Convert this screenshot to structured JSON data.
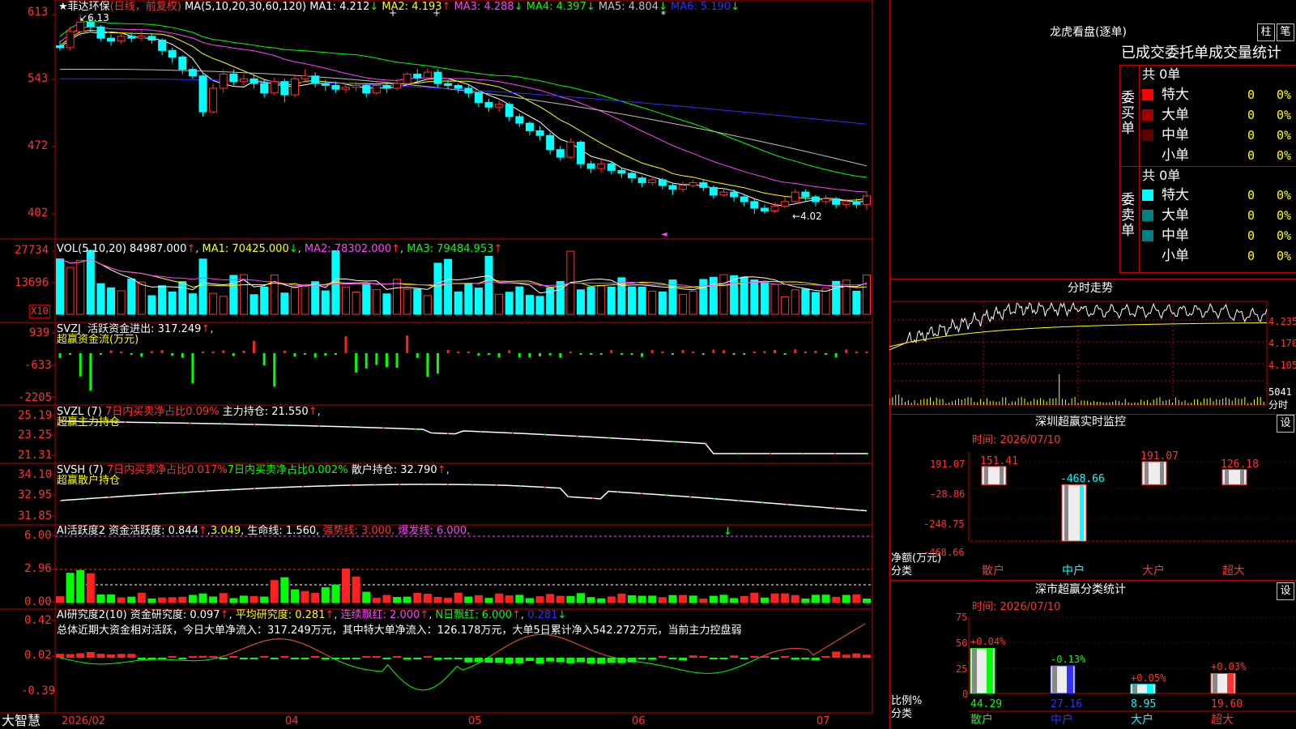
{
  "stock": {
    "name": "★菲达环保",
    "mode": "(日线，前复权)",
    "ma_label": "MA(5,10,20,30,60,120)",
    "ma": [
      {
        "label": "MA1:",
        "value": "4.212",
        "arrow": "↓",
        "color": "#ffffff"
      },
      {
        "label": "MA2:",
        "value": "4.193",
        "arrow": "↑",
        "color": "#ffff00"
      },
      {
        "label": "MA3:",
        "value": "4.288",
        "arrow": "↓",
        "color": "#ff40ff"
      },
      {
        "label": "MA4:",
        "value": "4.397",
        "arrow": "↓",
        "color": "#00ff00"
      },
      {
        "label": "MA5:",
        "value": "4.804",
        "arrow": "↓",
        "color": "#c0c0c0"
      },
      {
        "label": "MA6:",
        "value": "5.190",
        "arrow": "↓",
        "color": "#3030ff"
      }
    ],
    "high_mark": "6.13",
    "low_mark": "4.02",
    "price_axis": [
      "613",
      "543",
      "472",
      "402"
    ]
  },
  "vol": {
    "label": "VOL(5,10,20)",
    "value": "84987.000",
    "ma1": "MA1: 70425.000",
    "ma2": "MA2: 78302.000",
    "ma3": "MA3: 79484.953",
    "axis": [
      "27734",
      "13696"
    ],
    "unit": "X10"
  },
  "svzj": {
    "label": "SVZJ",
    "text": "活跃资金进出: 317.249",
    "sub": "超赢资金流(万元)",
    "axis": [
      "939",
      "-633",
      "-2205"
    ]
  },
  "svzl": {
    "label": "SVZL (7)",
    "t1": "7日内买卖净占比0.09%",
    "t2": "主力持仓: 21.550",
    "sub": "超赢主力持仓",
    "axis": [
      "25.19",
      "23.25",
      "21.31"
    ]
  },
  "svsh": {
    "label": "SVSH (7)",
    "t1": "7日内买卖净占比0.017%",
    "t2": "7日内买卖净占比0.002%",
    "t3": "散户持仓: 32.790",
    "sub": "超赢散户持仓",
    "axis": [
      "34.10",
      "32.95",
      "31.85"
    ]
  },
  "ai1": {
    "label": "AI活跃度2",
    "t1": "资金活跃度: 0.844",
    "t2": "3.049,",
    "t3": "生命线: 1.560,",
    "t4": "强势线: 3.000,",
    "t5": "爆发线: 6.000,",
    "axis": [
      "6.00",
      "2.96",
      "0.00"
    ]
  },
  "ai2": {
    "label": "AI研究度2(10)",
    "t1": "资金研究度: 0.097",
    "t2": "平均研究度: 0.281",
    "t3": "连续飘红: 2.000",
    "t4": "N日飘红: 6.000",
    "t5": "0.281",
    "summary": "总体近期大资金相对活跃，今日大单净流入：317.249万元，其中特大单净流入：126.178万元，大单5日累计净入542.272万元，当前主力控盘弱",
    "axis": [
      "0.42",
      "0.02",
      "-0.39"
    ]
  },
  "x_axis": [
    "2026/02",
    "04",
    "05",
    "06",
    "07"
  ],
  "brand": "大智慧",
  "right": {
    "longhu_title": "龙虎看盘(逐单)",
    "btn_zhu": "柱",
    "btn_bi": "笔",
    "stats_title": "已成交委托单成交量统计",
    "buy_label": "委买单",
    "sell_label": "委卖单",
    "buy_total": "共 0单",
    "sell_total": "共 0单",
    "buy_rows": [
      {
        "name": "特大",
        "val": "0",
        "pct": "0%",
        "color": "#ff0000"
      },
      {
        "name": "大单",
        "val": "0",
        "pct": "0%",
        "color": "#a00000"
      },
      {
        "name": "中单",
        "val": "0",
        "pct": "0%",
        "color": "#600000"
      },
      {
        "name": "小单",
        "val": "0",
        "pct": "0%",
        "color": "#000000"
      }
    ],
    "sell_rows": [
      {
        "name": "特大",
        "val": "0",
        "pct": "0%",
        "color": "#00ffff"
      },
      {
        "name": "大单",
        "val": "0",
        "pct": "0%",
        "color": "#008080"
      },
      {
        "name": "中单",
        "val": "0",
        "pct": "0%",
        "color": "#008080"
      },
      {
        "name": "小单",
        "val": "0",
        "pct": "0%",
        "color": "#000000"
      }
    ],
    "fenshi_title": "分时走势",
    "fenshi_axis": [
      "4.235",
      "4.170",
      "4.105"
    ],
    "fenshi_vol": "5041",
    "fenshi_vol_unit": "分时",
    "monitor_title": "深圳超赢实时监控",
    "monitor_btn": "设",
    "monitor_time": "时间: 2026/07/10",
    "monitor_axis": [
      "191.07",
      "-28.86",
      "-248.75",
      "-468.66"
    ],
    "monitor_ylabel": "净额(万元)",
    "monitor_xlabel": "分类",
    "monitor_bars": [
      {
        "cat": "散户",
        "value": "151.41",
        "v": 151.41
      },
      {
        "cat": "中户",
        "value": "-468.66",
        "v": -468.66
      },
      {
        "cat": "大户",
        "value": "191.07",
        "v": 191.07
      },
      {
        "cat": "超大",
        "value": "126.18",
        "v": 126.18
      }
    ],
    "class_title": "深市超赢分类统计",
    "class_btn": "设",
    "class_time": "时间: 2026/07/10",
    "class_axis": [
      "75",
      "50",
      "25",
      "0"
    ],
    "class_ylabel": "比例%",
    "class_xlabel": "分类",
    "class_bars": [
      {
        "cat": "散户",
        "value": "44.29",
        "delta": "+0.04%",
        "v": 44.29
      },
      {
        "cat": "中户",
        "value": "27.16",
        "delta": "-0.13%",
        "v": 27.16
      },
      {
        "cat": "大户",
        "value": "8.95",
        "delta": "+0.05%",
        "v": 8.95
      },
      {
        "cat": "超大",
        "value": "19.60",
        "delta": "+0.03%",
        "v": 19.6
      }
    ]
  },
  "colors": {
    "up": "#ff3232",
    "down": "#00ffff",
    "grid": "#c00000",
    "ma1": "#ffffff",
    "ma2": "#ffff00",
    "ma3": "#ff40ff",
    "ma4": "#00ff00",
    "ma5": "#c0c0c0",
    "ma6": "#3030ff"
  },
  "chart_data": {
    "type": "candlestick",
    "title": "菲达环保 日线",
    "candles": [
      [
        5.8,
        5.78,
        5.85,
        5.75
      ],
      [
        5.78,
        5.95,
        6.0,
        5.75
      ],
      [
        5.95,
        6.05,
        6.13,
        5.9
      ],
      [
        6.05,
        6.0,
        6.1,
        5.95
      ],
      [
        6.0,
        5.88,
        6.02,
        5.85
      ],
      [
        5.88,
        5.85,
        5.92,
        5.8
      ],
      [
        5.85,
        5.9,
        5.95,
        5.82
      ],
      [
        5.9,
        5.88,
        5.94,
        5.84
      ],
      [
        5.88,
        5.9,
        5.96,
        5.85
      ],
      [
        5.9,
        5.86,
        5.93,
        5.82
      ],
      [
        5.86,
        5.75,
        5.88,
        5.7
      ],
      [
        5.75,
        5.68,
        5.78,
        5.62
      ],
      [
        5.68,
        5.55,
        5.7,
        5.5
      ],
      [
        5.55,
        5.48,
        5.58,
        5.45
      ],
      [
        5.48,
        5.1,
        5.5,
        5.05
      ],
      [
        5.1,
        5.35,
        5.4,
        5.08
      ],
      [
        5.35,
        5.5,
        5.55,
        5.3
      ],
      [
        5.5,
        5.42,
        5.55,
        5.38
      ],
      [
        5.42,
        5.45,
        5.5,
        5.38
      ],
      [
        5.45,
        5.4,
        5.5,
        5.35
      ],
      [
        5.4,
        5.3,
        5.45,
        5.25
      ],
      [
        5.3,
        5.42,
        5.46,
        5.28
      ],
      [
        5.42,
        5.28,
        5.45,
        5.2
      ],
      [
        5.28,
        5.45,
        5.5,
        5.25
      ],
      [
        5.45,
        5.48,
        5.55,
        5.42
      ],
      [
        5.48,
        5.4,
        5.52,
        5.36
      ],
      [
        5.4,
        5.38,
        5.44,
        5.32
      ],
      [
        5.38,
        5.34,
        5.42,
        5.3
      ],
      [
        5.34,
        5.36,
        5.4,
        5.3
      ],
      [
        5.36,
        5.38,
        5.42,
        5.32
      ],
      [
        5.38,
        5.3,
        5.4,
        5.25
      ],
      [
        5.3,
        5.38,
        5.42,
        5.28
      ],
      [
        5.38,
        5.35,
        5.4,
        5.3
      ],
      [
        5.35,
        5.4,
        5.45,
        5.33
      ],
      [
        5.4,
        5.5,
        5.52,
        5.38
      ],
      [
        5.5,
        5.46,
        5.55,
        5.42
      ],
      [
        5.46,
        5.52,
        5.56,
        5.44
      ],
      [
        5.52,
        5.4,
        5.55,
        5.36
      ],
      [
        5.4,
        5.38,
        5.44,
        5.34
      ],
      [
        5.38,
        5.35,
        5.4,
        5.3
      ],
      [
        5.35,
        5.3,
        5.38,
        5.25
      ],
      [
        5.3,
        5.2,
        5.32,
        5.15
      ],
      [
        5.2,
        5.15,
        5.24,
        5.1
      ],
      [
        5.15,
        5.18,
        5.22,
        5.1
      ],
      [
        5.18,
        5.05,
        5.2,
        5.0
      ],
      [
        5.05,
        4.98,
        5.08,
        4.94
      ],
      [
        4.98,
        4.9,
        5.0,
        4.85
      ],
      [
        4.9,
        4.85,
        4.95,
        4.8
      ],
      [
        4.85,
        4.7,
        4.88,
        4.65
      ],
      [
        4.7,
        4.62,
        4.74,
        4.58
      ],
      [
        4.62,
        4.78,
        4.82,
        4.6
      ],
      [
        4.78,
        4.55,
        4.8,
        4.5
      ],
      [
        4.55,
        4.5,
        4.58,
        4.45
      ],
      [
        4.5,
        4.55,
        4.6,
        4.46
      ],
      [
        4.55,
        4.48,
        4.58,
        4.44
      ],
      [
        4.48,
        4.45,
        4.5,
        4.4
      ],
      [
        4.45,
        4.4,
        4.48,
        4.35
      ],
      [
        4.4,
        4.35,
        4.42,
        4.3
      ],
      [
        4.35,
        4.38,
        4.42,
        4.32
      ],
      [
        4.38,
        4.32,
        4.4,
        4.28
      ],
      [
        4.32,
        4.28,
        4.35,
        4.22
      ],
      [
        4.28,
        4.32,
        4.36,
        4.25
      ],
      [
        4.32,
        4.35,
        4.38,
        4.3
      ],
      [
        4.35,
        4.3,
        4.38,
        4.26
      ],
      [
        4.3,
        4.22,
        4.32,
        4.18
      ],
      [
        4.22,
        4.25,
        4.3,
        4.2
      ],
      [
        4.25,
        4.2,
        4.28,
        4.15
      ],
      [
        4.2,
        4.15,
        4.22,
        4.1
      ],
      [
        4.15,
        4.08,
        4.18,
        4.02
      ],
      [
        4.08,
        4.05,
        4.12,
        4.02
      ],
      [
        4.05,
        4.1,
        4.14,
        4.03
      ],
      [
        4.1,
        4.15,
        4.2,
        4.08
      ],
      [
        4.15,
        4.25,
        4.28,
        4.12
      ],
      [
        4.25,
        4.2,
        4.28,
        4.16
      ],
      [
        4.2,
        4.15,
        4.22,
        4.1
      ],
      [
        4.15,
        4.18,
        4.22,
        4.12
      ],
      [
        4.18,
        4.12,
        4.2,
        4.08
      ],
      [
        4.12,
        4.15,
        4.18,
        4.08
      ],
      [
        4.15,
        4.12,
        4.18,
        4.08
      ],
      [
        4.12,
        4.21,
        4.25,
        4.06
      ]
    ],
    "ylim": [
      4.02,
      6.13
    ]
  }
}
